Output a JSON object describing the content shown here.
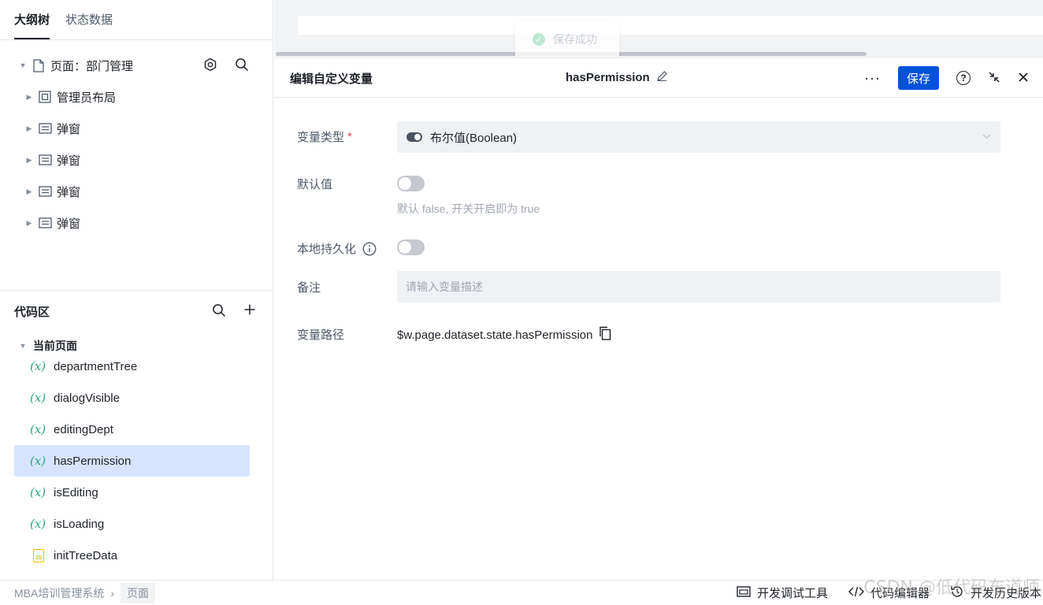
{
  "left": {
    "tabs": [
      {
        "label": "大纲树",
        "active": true
      },
      {
        "label": "状态数据",
        "active": false
      }
    ],
    "tree": {
      "root": {
        "label": "页面：部门管理",
        "icon": "page-icon"
      },
      "children": [
        {
          "label": "管理员布局",
          "icon": "layout-icon"
        },
        {
          "label": "弹窗",
          "icon": "dialog-icon"
        },
        {
          "label": "弹窗",
          "icon": "dialog-icon"
        },
        {
          "label": "弹窗",
          "icon": "dialog-icon"
        },
        {
          "label": "弹窗",
          "icon": "dialog-icon"
        }
      ]
    },
    "code": {
      "title": "代码区",
      "group": "当前页面",
      "items": [
        {
          "label": "departmentTree",
          "kind": "variable"
        },
        {
          "label": "dialogVisible",
          "kind": "variable"
        },
        {
          "label": "editingDept",
          "kind": "variable"
        },
        {
          "label": "hasPermission",
          "kind": "variable",
          "selected": true
        },
        {
          "label": "isEditing",
          "kind": "variable"
        },
        {
          "label": "isLoading",
          "kind": "variable"
        },
        {
          "label": "initTreeData",
          "kind": "js"
        }
      ],
      "var_glyph": "(x)",
      "js_glyph": "JS"
    }
  },
  "toast": {
    "text": "保存成功"
  },
  "editor": {
    "title": "编辑自定义变量",
    "var_name": "hasPermission",
    "save_label": "保存",
    "more_label": "···",
    "help_glyph": "?",
    "form": {
      "type_label": "变量类型",
      "required_mark": "*",
      "type_value": "布尔值(Boolean)",
      "default_label": "默认值",
      "default_hint": "默认 false, 开关开启即为 true",
      "default_value": false,
      "persist_label": "本地持久化",
      "persist_value": false,
      "remark_label": "备注",
      "remark_placeholder": "请输入变量描述",
      "path_label": "变量路径",
      "path_value": "$w.page.dataset.state.hasPermission"
    }
  },
  "bottom": {
    "breadcrumb": [
      "MBA培训管理系统",
      "页面"
    ],
    "actions": [
      "开发调试工具",
      "代码编辑器",
      "开发历史版本"
    ]
  },
  "watermark": "CSDN @低代码布道师",
  "colors": {
    "primary": "#0052d9",
    "selected_bg": "#d6e4ff",
    "var_icon": "#2ea87a",
    "js_icon": "#f7b500"
  }
}
